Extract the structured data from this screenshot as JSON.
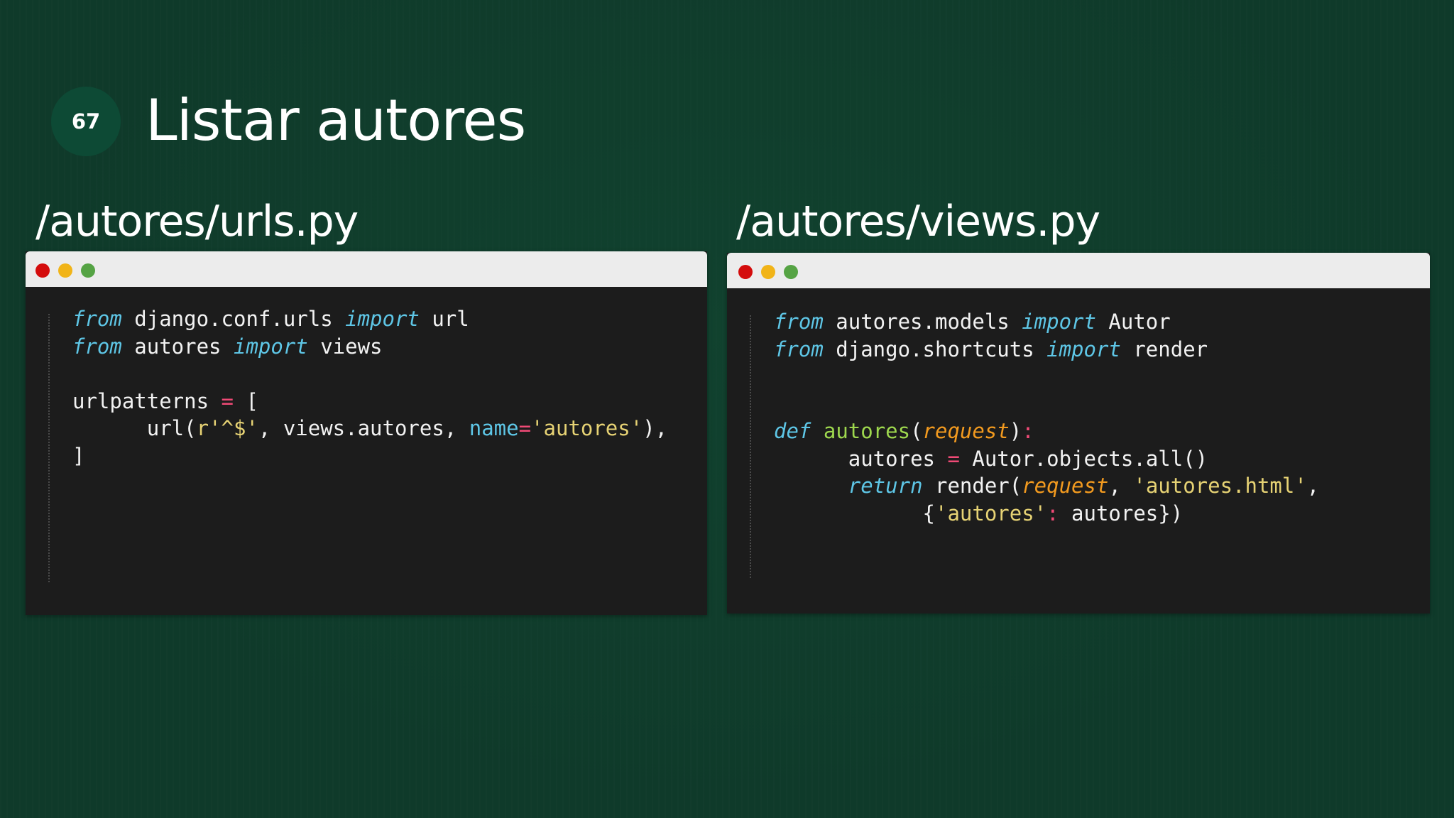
{
  "slide": {
    "number": "67",
    "title": "Listar autores"
  },
  "panels": {
    "left": {
      "heading": "/autores/urls.py"
    },
    "right": {
      "heading": "/autores/views.py"
    }
  },
  "colors": {
    "background": "#0f3a2a",
    "badge": "#0d4a35",
    "code_background": "#1c1c1c",
    "window_bar": "#ececec",
    "dot_red": "#d40c0c",
    "dot_yellow": "#f1b418",
    "dot_green": "#55a344",
    "keyword": "#5ec6e6",
    "operator": "#f04a76",
    "string": "#e6d274",
    "parameter": "#f29a1f",
    "function_name": "#9ed84e"
  },
  "code": {
    "left": {
      "l1": {
        "from": "from",
        "mod": " django.conf.urls ",
        "import": "import",
        "name": " url"
      },
      "l2": {
        "from": "from",
        "mod": " autores ",
        "import": "import",
        "name": " views"
      },
      "l4": {
        "name": "urlpatterns ",
        "eq": "=",
        "open": " ["
      },
      "l5": {
        "indent": "      ",
        "call": "url(",
        "regex": "r'^$'",
        "sep": ", views.autores, ",
        "kw": "name",
        "eq": "=",
        "str": "'autores'",
        "close": "),"
      },
      "l6": {
        "close": "]"
      }
    },
    "right": {
      "l1": {
        "from": "from",
        "mod": " autores.models ",
        "import": "import",
        "name": " Autor"
      },
      "l2": {
        "from": "from",
        "mod": " django.shortcuts ",
        "import": "import",
        "name": " render"
      },
      "l5": {
        "def": "def",
        "space": " ",
        "fname": "autores",
        "open": "(",
        "param": "request",
        "close": ")",
        "colon": ":"
      },
      "l6": {
        "indent": "      ",
        "name": "autores ",
        "eq": "=",
        "rest": " Autor.objects.all()"
      },
      "l7": {
        "indent": "      ",
        "ret": "return",
        "call": " render(",
        "param": "request",
        "sep": ", ",
        "str": "'autores.html'",
        "end": ","
      },
      "l8": {
        "indent": "            ",
        "open": "{",
        "str": "'autores'",
        "colon": ":",
        "rest": " autores})"
      }
    }
  }
}
